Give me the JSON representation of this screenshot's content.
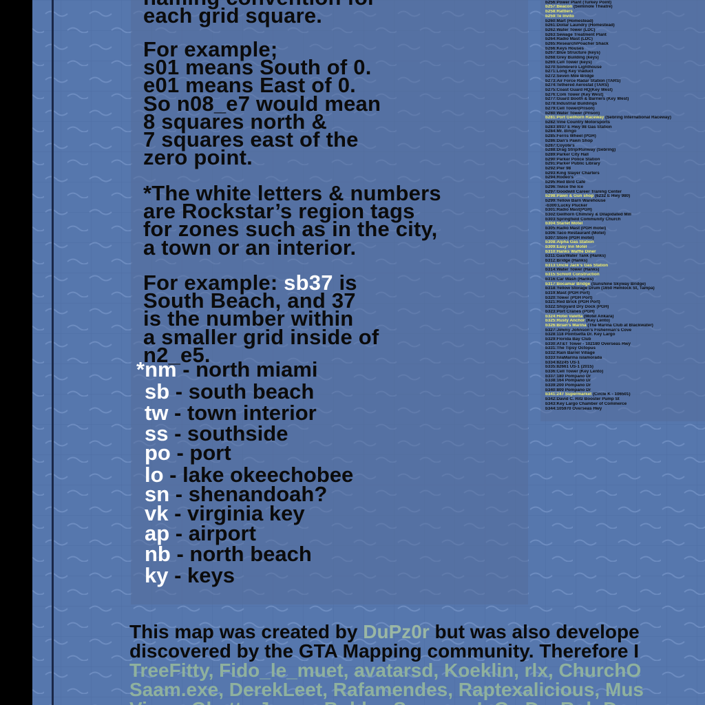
{
  "intro": {
    "cut_line": "naming convention for",
    "line2": "each grid square."
  },
  "example1": {
    "lines": [
      "For example;",
      "s01 means South of 0.",
      "e01 means East of 0.",
      "So n08_e7 would mean",
      "8 squares north &",
      "7 squares east of the",
      "zero point."
    ]
  },
  "note": {
    "lines": [
      "*The white letters & numbers",
      "are Rockstar’s region tags",
      "for zones such as in the city,",
      "a town or an interior."
    ]
  },
  "example2": {
    "prefix": "For example: ",
    "tag": "sb37",
    "suffix": " is",
    "lines": [
      "South Beach, and 37",
      "is the number within",
      "a smaller grid inside of",
      "n2_e5."
    ]
  },
  "legend": [
    {
      "star": "*",
      "code": "nm",
      "desc": " - north miami"
    },
    {
      "code": "sb",
      "desc": " - south beach"
    },
    {
      "code": "tw",
      "desc": " - town interior"
    },
    {
      "code": "ss",
      "desc": " - southside"
    },
    {
      "code": "po",
      "desc": " - port"
    },
    {
      "code": "lo",
      "desc": " - lake okeechobee"
    },
    {
      "code": "sn",
      "desc": " - shenandoah?"
    },
    {
      "code": "vk",
      "desc": " - virginia key"
    },
    {
      "code": "ap",
      "desc": " - airport"
    },
    {
      "code": "nb",
      "desc": " - north beach"
    },
    {
      "code": "ky",
      "desc": " - keys"
    }
  ],
  "credits": {
    "line1_prefix": "This map was created by ",
    "author": "DuPz0r",
    "line1_suffix": " but was also develope",
    "line2": "discovered by the GTA Mapping community. Therefore I",
    "line3": "TreeFitty, Fido_le_muet, avatarsd, Koeklin, rlx, ChurchO",
    "line4": "Saam.exe, DerekLeet, Rafamendes, Raptexalicious, Mus",
    "line5": "Vince, Ghetto Jesus, Bobby, Saveme, L.G., D... Rob D"
  },
  "buildings": [
    {
      "id": "b255:",
      "name": "Bridge (Trailer 1 - 00:03)"
    },
    {
      "id": "b256:",
      "name": "Power Plant (Turkey Point)"
    },
    {
      "id": "b257:",
      "name": "Beacon",
      "yellow": true,
      "extra": " (Seminole Theatre)"
    },
    {
      "id": "b258:",
      "name": "Rattlers",
      "yellow": true
    },
    {
      "id": "b259:",
      "name": "Te Invito",
      "yellow": true
    },
    {
      "id": "b260:",
      "name": "Mart (Homestead)"
    },
    {
      "id": "b261:",
      "name": "Dollar Laundry (Homestead)"
    },
    {
      "id": "b262:",
      "name": "Water Tower (LDC)"
    },
    {
      "id": "b263:",
      "name": "Sewage Treatment Plant"
    },
    {
      "id": "b264:",
      "name": "Radio Mast (LDC)"
    },
    {
      "id": "b265:",
      "name": "Research/Poacher Shack"
    },
    {
      "id": "b266:",
      "name": "Keys Houses"
    },
    {
      "id": "b267:",
      "name": "Blue Structure (keys)"
    },
    {
      "id": "b268:",
      "name": "Grey Building (keys)"
    },
    {
      "id": "b269:",
      "name": "Cell Tower (keys)"
    },
    {
      "id": "b270:",
      "name": "Sombrero Lighthouse"
    },
    {
      "id": "b271:",
      "name": "Long Key Viaduct"
    },
    {
      "id": "b272:",
      "name": "Seven Mile Bridge"
    },
    {
      "id": "b273:",
      "name": "Air Force Radar Station (TARS)"
    },
    {
      "id": "b274:",
      "name": "Tethered Aerostat (TARS)"
    },
    {
      "id": "b275:",
      "name": "Coast Guard HQ(Key West)"
    },
    {
      "id": "b276:",
      "name": "Com Tower (Key West)"
    },
    {
      "id": "b277:",
      "name": "Guard Booth & Barriers (Key West)"
    },
    {
      "id": "b278:",
      "name": "Industrial Buildings"
    },
    {
      "id": "b279:",
      "name": "Cell Tower(Prison)"
    },
    {
      "id": "b280:",
      "name": "Water Tower (Prison)"
    },
    {
      "id": "b281:",
      "name": "Port Geilhorn Raceway",
      "yellow": true,
      "extra": " (Sebring International Raceway)"
    },
    {
      "id": "b282:",
      "name": "Vine Country Motorsports"
    },
    {
      "id": "b283:",
      "name": "8937 E Hwy 98 Gas Station"
    },
    {
      "id": "b284:",
      "name": "Mr. Bingo"
    },
    {
      "id": "b285:",
      "name": "Ferris Wheel (PGH)"
    },
    {
      "id": "b286:",
      "name": "Dan's Pawn Shop"
    },
    {
      "id": "b287:",
      "name": "Coyote's"
    },
    {
      "id": "b288:",
      "name": "Drag Strip/Runway (Sebring)"
    },
    {
      "id": "b289:",
      "name": "Parker City Hall"
    },
    {
      "id": "b290:",
      "name": "Parker Police Station"
    },
    {
      "id": "b291:",
      "name": "Parker Public Library"
    },
    {
      "id": "b292:",
      "name": "Pier 98"
    },
    {
      "id": "b293:",
      "name": "King Slayer Charters"
    },
    {
      "id": "b294:",
      "name": "Rodeo's"
    },
    {
      "id": "b295:",
      "name": "Red Bird Café"
    },
    {
      "id": "b296:",
      "name": "Twice the Ice"
    },
    {
      "id": "b297:",
      "name": "Goodwill Career Traning Center"
    },
    {
      "id": "b298:",
      "name": "Pawn & Gun shop",
      "yellow": true,
      "extra": " (6232 E Hwy 980)"
    },
    {
      "id": "b299:",
      "name": "Yellow Barn Warehouse"
    },
    {
      "id": "-b300:",
      "name": "Lucky Plucker"
    },
    {
      "id": "b301:",
      "name": "Radio Mast(PGH)"
    },
    {
      "id": "b302:",
      "name": "Geilhorn Chimney & Dilapidated Mill"
    },
    {
      "id": "b303:",
      "name": "Springfield Community Church"
    },
    {
      "id": "b304:",
      "name": "Starlet Motel",
      "yellow": true
    },
    {
      "id": "b305:",
      "name": "Radio Mast (PGH motel)"
    },
    {
      "id": "b306:",
      "name": "Taco Restaurant (Motel)"
    },
    {
      "id": "b307:",
      "name": "Store (PGH motel)"
    },
    {
      "id": "b308:",
      "name": "Alpha Gas Station",
      "yellow": true
    },
    {
      "id": "b309:",
      "name": "Easy Inn Motel",
      "yellow": true
    },
    {
      "id": "b310:",
      "name": "Hanks Waffle Diner",
      "yellow": true
    },
    {
      "id": "b311:",
      "name": "Gas/Water Tank (Hanks)"
    },
    {
      "id": "b312:",
      "name": "Bridge (Hanks)"
    },
    {
      "id": "b313:",
      "name": "Uncle Jack's Gas Station",
      "yellow": true
    },
    {
      "id": "b314:",
      "name": "Water Tower (Hanks)"
    },
    {
      "id": "b315:",
      "name": "Schlott Construction",
      "yellow": true
    },
    {
      "id": "b316:",
      "name": "Car Wash (Hanks)"
    },
    {
      "id": "b317:",
      "name": "Bocamar Bridge",
      "yellow": true,
      "extra": " (Sunshine Skyway Bridge)"
    },
    {
      "id": "b318:",
      "name": "Yellow Storage Drum (1650 Hemlock St, Tampa)"
    },
    {
      "id": "b319:",
      "name": "Mast (PGH Port)"
    },
    {
      "id": "b320:",
      "name": "Tower (PGH Port)"
    },
    {
      "id": "b321:",
      "name": "Red Brick (PGH Port)"
    },
    {
      "id": "b322:",
      "name": "Shipyard Dry Dock (PGH)"
    },
    {
      "id": "b323:",
      "name": "Port Cranes (PGH)"
    },
    {
      "id": "b324:",
      "name": "Hotel Valetta",
      "yellow": true,
      "extra": " (Motel Ankara)"
    },
    {
      "id": "b325:",
      "name": "Rusty Anchor",
      "yellow": true,
      "extra": " (Key Lento)"
    },
    {
      "id": "b326:",
      "name": "Brian's Marina",
      "yellow": true,
      "extra": " (The Marina Club at Blackwater)"
    },
    {
      "id": "b327:",
      "name": "Jimmy Johnson's Fisherman's Cove"
    },
    {
      "id": "b328:",
      "name": "118 Pointsetta Dr. Key Largo"
    },
    {
      "id": "b329:",
      "name": "Florida Bay Club"
    },
    {
      "id": "b330:",
      "name": "AT&T Tower - 102180 Overseas Hwy"
    },
    {
      "id": "b331:",
      "name": "The Tipsy Octopus"
    },
    {
      "id": "b332:",
      "name": "Rain Barrel Village"
    },
    {
      "id": "b333:",
      "name": "IslaMarina islamorada"
    },
    {
      "id": "b334:",
      "name": "82245 US-1"
    },
    {
      "id": "b335:",
      "name": "82661 US-1 (2015)"
    },
    {
      "id": "b336:",
      "name": "Cell Tower (Key Lento)"
    },
    {
      "id": "b337:",
      "name": "180 Pompano Dr"
    },
    {
      "id": "b338:",
      "name": "164 Pompano Dr"
    },
    {
      "id": "b339:",
      "name": "200 Pompano Dr"
    },
    {
      "id": "b340:",
      "name": "800 Pompano Dr"
    },
    {
      "id": "b341:",
      "name": "247 Supermarket",
      "yellow": true,
      "extra": " (Circle K - 106501)"
    },
    {
      "id": "b342:",
      "name": "David C. Ritz Booster Pump St"
    },
    {
      "id": "b343:",
      "name": "Key Largo Chamber of Commerce"
    },
    {
      "id": "b344:",
      "name": "105970 Overseas Hwy"
    }
  ]
}
